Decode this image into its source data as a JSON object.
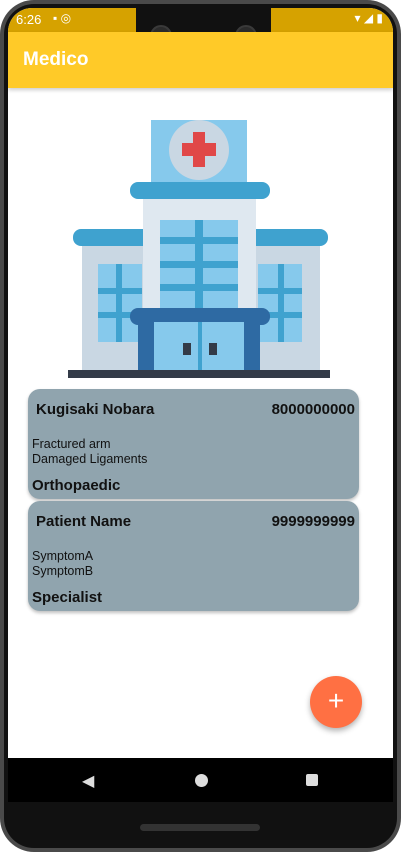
{
  "status": {
    "time": "6:26",
    "left_icons": "▪ ◎",
    "right_icons": "▾ ◢ ▮"
  },
  "app": {
    "title": "Medico"
  },
  "patients": [
    {
      "name": "Kugisaki Nobara",
      "phone": "8000000000",
      "symptoms": [
        "Fractured arm",
        "Damaged Ligaments"
      ],
      "specialist": "Orthopaedic"
    },
    {
      "name": "Patient Name",
      "phone": "9999999999",
      "symptoms": [
        "SymptomA",
        "SymptomB"
      ],
      "specialist": "Specialist"
    }
  ],
  "fab": {
    "label": "+",
    "icon": "add-icon"
  },
  "nav": {
    "back_icon": "back-icon",
    "home_icon": "home-icon",
    "recent_icon": "recent-apps-icon"
  },
  "colors": {
    "appbar": "#ffca28",
    "card": "#90a4ae",
    "fab": "#ff7043"
  }
}
